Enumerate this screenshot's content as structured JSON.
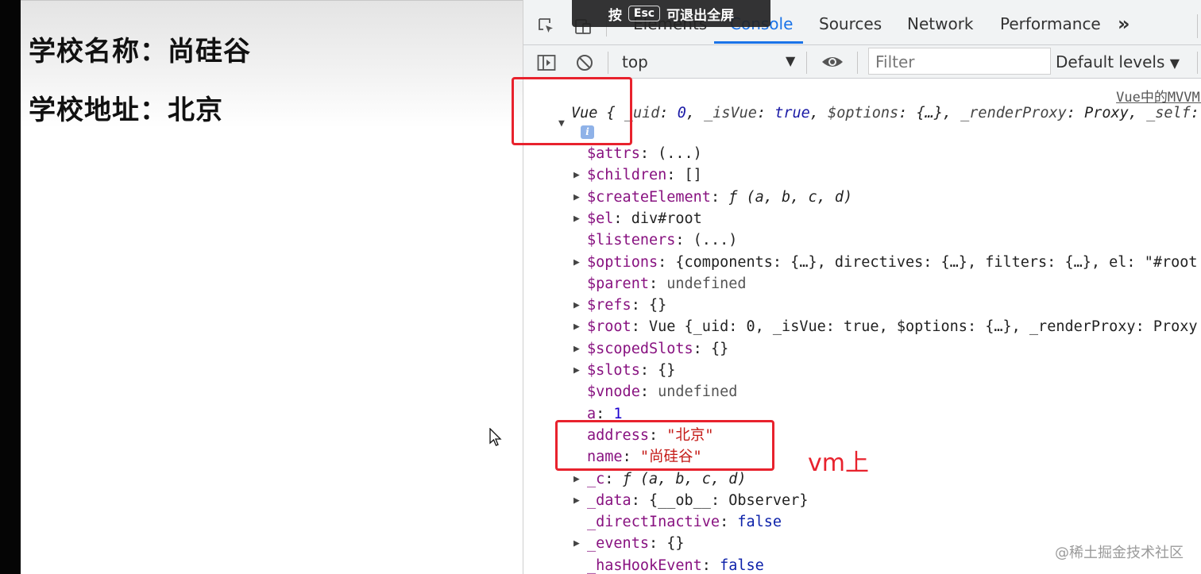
{
  "page": {
    "school_name": "学校名称：尚硅谷",
    "school_address": "学校地址：北京"
  },
  "esc_banner": {
    "prefix": "按",
    "key": "Esc",
    "suffix": "可退出全屏"
  },
  "devtools": {
    "tabs": [
      {
        "label": "Elements"
      },
      {
        "label": "Console",
        "active": true
      },
      {
        "label": "Sources"
      },
      {
        "label": "Network"
      },
      {
        "label": "Performance"
      }
    ],
    "more_tabs_label": "»",
    "toolbar": {
      "context": "top",
      "filter_placeholder": "Filter",
      "levels": "Default levels"
    },
    "accent_color": "#1a73e8"
  },
  "console": {
    "source_link": "Vue中的MVVM.",
    "summary": {
      "prefix": "Vue {",
      "parts": [
        {
          "k": "_uid",
          "v": "0"
        },
        {
          "k": "_isVue",
          "v": "true"
        },
        {
          "k": "$options",
          "v": "{…}"
        },
        {
          "k": "_renderProxy",
          "v": "Proxy"
        },
        {
          "k": "_self",
          "v": ""
        }
      ]
    },
    "info_badge": "i",
    "properties": [
      {
        "key": "$attrs",
        "value": "(...)",
        "expandable": false,
        "kind": "plain"
      },
      {
        "key": "$children",
        "value": "[]",
        "expandable": true,
        "kind": "plain"
      },
      {
        "key": "$createElement",
        "value": "ƒ (a, b, c, d)",
        "expandable": true,
        "kind": "fn"
      },
      {
        "key": "$el",
        "value": "div#root",
        "expandable": true,
        "kind": "plain"
      },
      {
        "key": "$listeners",
        "value": "(...)",
        "expandable": false,
        "kind": "plain"
      },
      {
        "key": "$options",
        "value": "{components: {…}, directives: {…}, filters: {…}, el: \"#root",
        "expandable": true,
        "kind": "plain"
      },
      {
        "key": "$parent",
        "value": "undefined",
        "expandable": false,
        "kind": "muted"
      },
      {
        "key": "$refs",
        "value": "{}",
        "expandable": true,
        "kind": "plain"
      },
      {
        "key": "$root",
        "value": "Vue {_uid: 0, _isVue: true, $options: {…}, _renderProxy: Proxy",
        "expandable": true,
        "kind": "plain"
      },
      {
        "key": "$scopedSlots",
        "value": "{}",
        "expandable": true,
        "kind": "plain"
      },
      {
        "key": "$slots",
        "value": "{}",
        "expandable": true,
        "kind": "plain"
      },
      {
        "key": "$vnode",
        "value": "undefined",
        "expandable": false,
        "kind": "muted"
      },
      {
        "key": "a",
        "value": "1",
        "expandable": false,
        "kind": "num"
      },
      {
        "key": "address",
        "value": "\"北京\"",
        "expandable": false,
        "kind": "str"
      },
      {
        "key": "name",
        "value": "\"尚硅谷\"",
        "expandable": false,
        "kind": "str"
      },
      {
        "key": "_c",
        "value": "ƒ (a, b, c, d)",
        "expandable": true,
        "kind": "fn"
      },
      {
        "key": "_data",
        "value": "{__ob__: Observer}",
        "expandable": true,
        "kind": "plain"
      },
      {
        "key": "_directInactive",
        "value": "false",
        "expandable": false,
        "kind": "kw"
      },
      {
        "key": "_events",
        "value": "{}",
        "expandable": true,
        "kind": "plain"
      },
      {
        "key": "_hasHookEvent",
        "value": "false",
        "expandable": false,
        "kind": "kw"
      }
    ]
  },
  "annotation": {
    "text": "vm上",
    "color": "#e8222d"
  },
  "watermark": "@稀土掘金技术社区"
}
